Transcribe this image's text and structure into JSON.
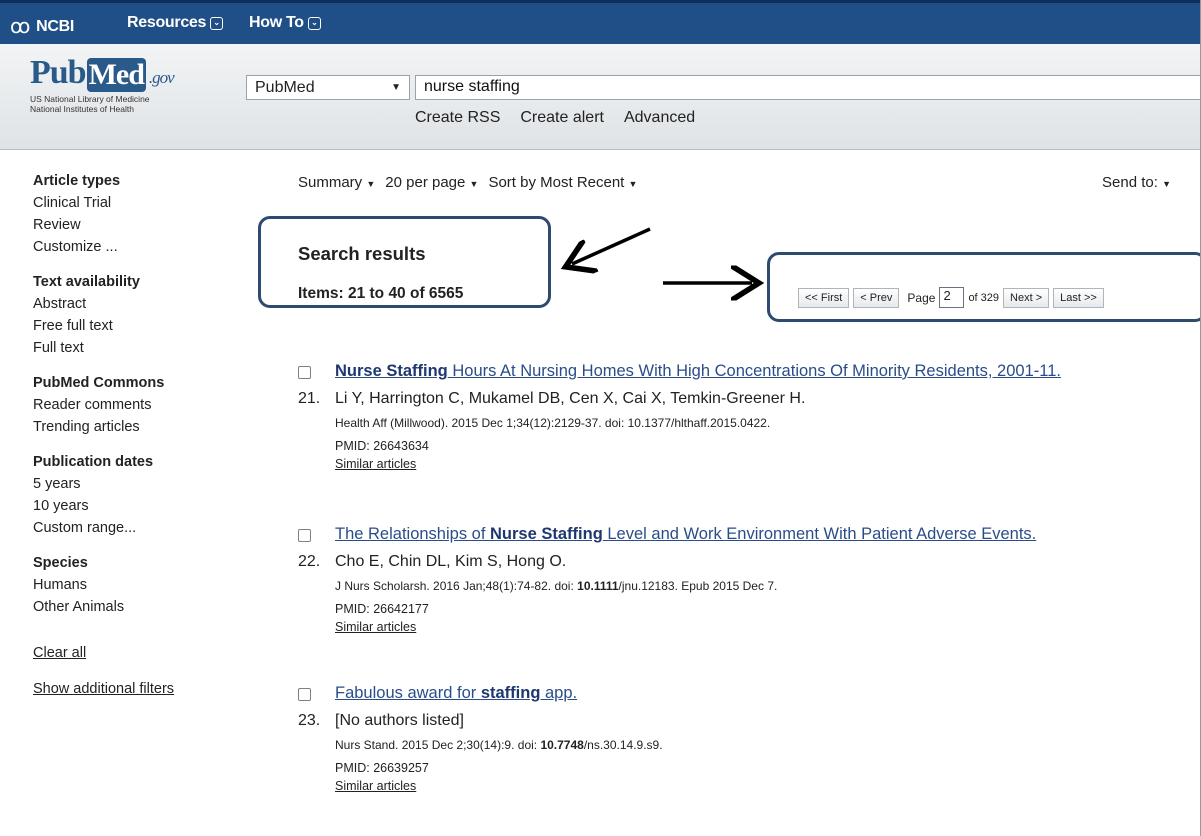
{
  "topbar": {
    "logo_label": "NCBI",
    "logo_glyph": "ꝏ",
    "resources_label": "Resources",
    "howto_label": "How To",
    "caret_icon": "⌄"
  },
  "header": {
    "brand_pub": "Pub",
    "brand_med": "Med",
    "brand_gov": ".gov",
    "brand_sub_1": "US National Library of Medicine",
    "brand_sub_2": "National Institutes of Health",
    "db_select_value": "PubMed",
    "search_value": "nurse staffing",
    "links": [
      "Create RSS",
      "Create alert",
      "Advanced"
    ]
  },
  "sidebar": {
    "groups": [
      {
        "title": "Article types",
        "items": [
          "Clinical Trial",
          "Review",
          "Customize ..."
        ]
      },
      {
        "title": "Text availability",
        "items": [
          "Abstract",
          "Free full text",
          "Full text"
        ]
      },
      {
        "title": "PubMed Commons",
        "items": [
          "Reader comments",
          "Trending articles"
        ]
      },
      {
        "title": "Publication dates",
        "items": [
          "5 years",
          "10 years",
          "Custom range..."
        ]
      },
      {
        "title": "Species",
        "items": [
          "Humans",
          "Other Animals"
        ]
      }
    ],
    "clear_all": "Clear all",
    "show_filters": "Show additional filters"
  },
  "toolbar": {
    "summary": "Summary",
    "per_page": "20 per page",
    "sort": "Sort by Most Recent",
    "send_to": "Send to:"
  },
  "results_header": {
    "title": "Search results",
    "items": "Items: 21 to 40 of 6565"
  },
  "pager": {
    "first": "<< First",
    "prev": "< Prev",
    "page_label": "Page",
    "page_value": "2",
    "of_label": "of 329",
    "next": "Next >",
    "last": "Last >>"
  },
  "results": [
    {
      "num": "21.",
      "title_bold": "Nurse Staffing",
      "title_rest": " Hours At Nursing Homes With High Concentrations Of Minority Residents, 2001-11.",
      "authors": "Li Y, Harrington C, Mukamel DB, Cen X, Cai X, Temkin-Greener H.",
      "journal": "Health Aff (Millwood). 2015 Dec 1;34(12):2129-37. doi: 10.1377/hlthaff.2015.0422.",
      "pmid": "PMID: 26643634",
      "similar": "Similar articles"
    },
    {
      "num": "22.",
      "title_pre": "The Relationships of ",
      "title_bold": "Nurse Staffing",
      "title_rest": " Level and Work Environment With Patient Adverse Events.",
      "authors": "Cho E, Chin DL, Kim S, Hong O.",
      "journal_pre": "J Nurs Scholarsh. 2016 Jan;48(1):74-82. doi: ",
      "journal_bold": "10.1111",
      "journal_post": "/jnu.12183. Epub 2015 Dec 7.",
      "pmid": "PMID: 26642177",
      "similar": "Similar articles"
    },
    {
      "num": "23.",
      "title_pre": "Fabulous award for ",
      "title_bold": "staffing",
      "title_rest": " app.",
      "authors": "[No authors listed]",
      "journal_pre": "Nurs Stand. 2015 Dec 2;30(14):9. doi: ",
      "journal_bold": "10.7748",
      "journal_post": "/ns.30.14.9.s9.",
      "pmid": "PMID: 26639257",
      "similar": "Similar articles"
    }
  ],
  "colors": {
    "ncbi_bar": "#1f4f86",
    "callout_border": "#2e4a6e",
    "link_title": "#2a4d8a"
  }
}
